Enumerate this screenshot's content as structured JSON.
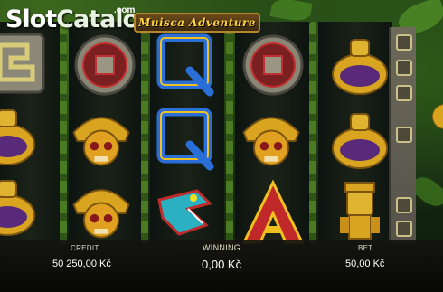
{
  "logo": {
    "slot": "Slot",
    "catalog": "Catalog",
    "com": ".com"
  },
  "game": {
    "title": "Muisca Adventure"
  },
  "reels": [
    [
      "stone-glyph",
      "golden-vase",
      "golden-vase"
    ],
    [
      "stone-medallion",
      "golden-skull-mask",
      "golden-skull-mask"
    ],
    [
      "blue-q",
      "blue-q",
      "serpent-head"
    ],
    [
      "stone-medallion",
      "golden-skull-mask",
      "red-a"
    ],
    [
      "golden-vase",
      "golden-vase",
      "golden-idol"
    ]
  ],
  "bottom": {
    "credit_label": "CREDIT",
    "credit_value": "50 250,00 Kč",
    "winning_label": "WINNING",
    "winning_value": "0,00 Kč",
    "bet_label": "BET",
    "bet_value": "50,00 Kč"
  },
  "colors": {
    "gold": "#d9a520",
    "purple": "#5a2a7a",
    "blue": "#2a6fd8",
    "red": "#c0282a"
  }
}
